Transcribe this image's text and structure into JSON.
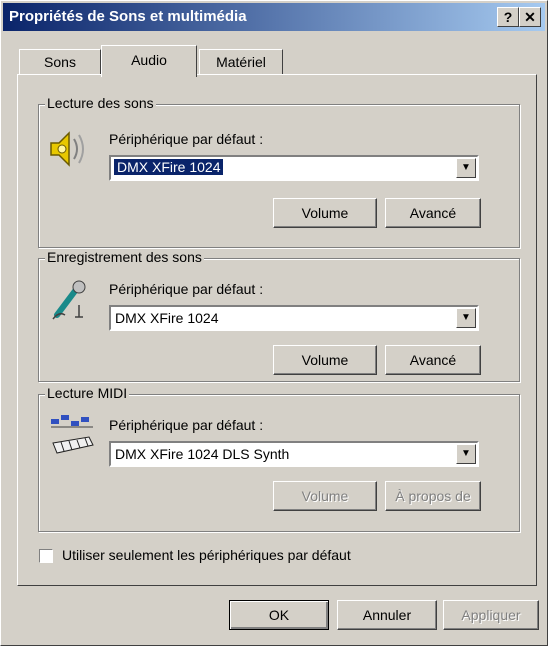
{
  "window": {
    "title": "Propriétés de Sons et multimédia",
    "help_button": "?",
    "close_button": "✕"
  },
  "tabs": [
    {
      "label": "Sons",
      "active": false
    },
    {
      "label": "Audio",
      "active": true
    },
    {
      "label": "Matériel",
      "active": false
    }
  ],
  "groups": {
    "playback": {
      "label": "Lecture des sons",
      "device_label": "Périphérique par défaut :",
      "device_value": "DMX XFire 1024",
      "volume_label": "Volume",
      "advanced_label": "Avancé",
      "icon": "speaker-icon"
    },
    "recording": {
      "label": "Enregistrement des sons",
      "device_label": "Périphérique par défaut :",
      "device_value": "DMX XFire 1024",
      "volume_label": "Volume",
      "advanced_label": "Avancé",
      "icon": "microphone-icon"
    },
    "midi": {
      "label": "Lecture MIDI",
      "device_label": "Périphérique par défaut :",
      "device_value": "DMX XFire 1024 DLS Synth",
      "volume_label": "Volume",
      "about_label": "À propos de",
      "icon": "midi-keyboard-icon"
    }
  },
  "checkbox": {
    "label": "Utiliser seulement les périphériques par défaut",
    "checked": false
  },
  "footer": {
    "ok_label": "OK",
    "cancel_label": "Annuler",
    "apply_label": "Appliquer"
  }
}
